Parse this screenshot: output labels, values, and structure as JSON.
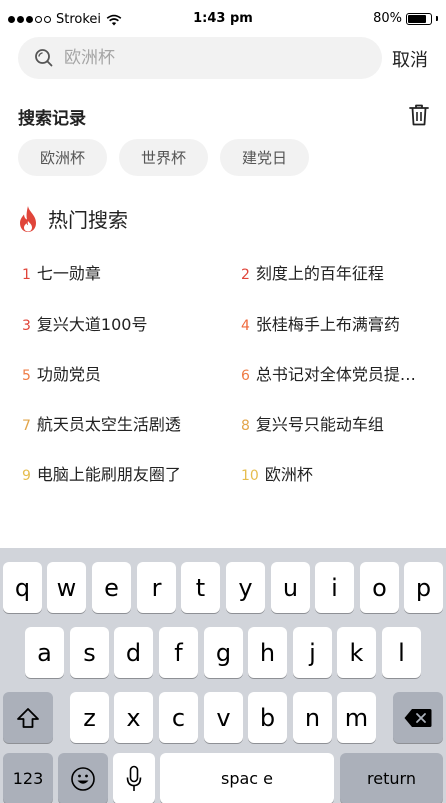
{
  "status_bar": {
    "carrier": "Strokei",
    "time": "1:43 pm",
    "battery": "80%",
    "battery_level": 0.8
  },
  "search": {
    "placeholder": "欧洲杯",
    "cancel_label": "取消"
  },
  "history": {
    "title": "搜索记录",
    "tags": [
      "欧洲杯",
      "世界杯",
      "建党日"
    ]
  },
  "hot": {
    "title": "热门搜索",
    "items": [
      {
        "rank": "1",
        "text": "七一勋章",
        "color": "#e0453a"
      },
      {
        "rank": "2",
        "text": "刻度上的百年征程",
        "color": "#e0453a"
      },
      {
        "rank": "3",
        "text": "复兴大道100号",
        "color": "#e0453a"
      },
      {
        "rank": "4",
        "text": "张桂梅手上布满膏药",
        "color": "#ef6a3d"
      },
      {
        "rank": "5",
        "text": "功勋党员",
        "color": "#ef7c45"
      },
      {
        "rank": "6",
        "text": "总书记对全体党员提…",
        "color": "#ef7c45"
      },
      {
        "rank": "7",
        "text": "航天员太空生活剧透",
        "color": "#e2a54a"
      },
      {
        "rank": "8",
        "text": "复兴号只能动车组",
        "color": "#e2a54a"
      },
      {
        "rank": "9",
        "text": "电脑上能刷朋友圈了",
        "color": "#e6bd4f"
      },
      {
        "rank": "10",
        "text": "欧洲杯",
        "color": "#e6bd4f"
      }
    ]
  },
  "keyboard": {
    "row1": [
      "q",
      "w",
      "e",
      "r",
      "t",
      "y",
      "u",
      "i",
      "o",
      "p"
    ],
    "row2": [
      "a",
      "s",
      "d",
      "f",
      "g",
      "h",
      "j",
      "k",
      "l"
    ],
    "row3": [
      "z",
      "x",
      "c",
      "v",
      "b",
      "n",
      "m"
    ],
    "numbers_label": "123",
    "space_label": "spac e",
    "return_label": "return"
  },
  "colors": {
    "flame": "#e0453a",
    "tag_bg": "#f2f2f2",
    "keyboard_bg": "#d1d4da"
  }
}
